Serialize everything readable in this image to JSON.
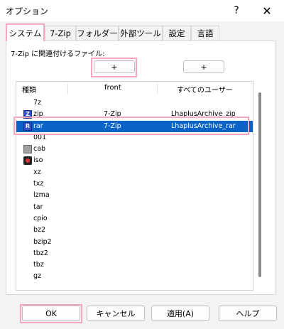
{
  "window": {
    "title": "オプション",
    "help_glyph": "?",
    "close_glyph": "✕"
  },
  "tabs": [
    {
      "label": "システム",
      "active": true
    },
    {
      "label": "7-Zip"
    },
    {
      "label": "フォルダー"
    },
    {
      "label": "外部ツール"
    },
    {
      "label": "設定"
    },
    {
      "label": "言語"
    }
  ],
  "assoc": {
    "label": "7-Zip に関連付けるファイル:",
    "plus_button_1": "+",
    "plus_button_2": "+"
  },
  "list": {
    "columns": [
      "種類",
      "front",
      "すべてのユーザー"
    ],
    "rows": [
      {
        "ext": "7z",
        "front": "",
        "all": "",
        "icon": ""
      },
      {
        "ext": "zip",
        "front": "7-Zip",
        "all": "LhaplusArchive_zip",
        "icon": "zip-archive-icon",
        "icon_glyph": "Z"
      },
      {
        "ext": "rar",
        "front": "7-Zip",
        "all": "LhaplusArchive_rar",
        "icon": "rar-archive-icon",
        "icon_glyph": "R",
        "selected": true
      },
      {
        "ext": "001",
        "front": "",
        "all": "",
        "icon": ""
      },
      {
        "ext": "cab",
        "front": "",
        "all": "",
        "icon": "cab-archive-icon"
      },
      {
        "ext": "iso",
        "front": "",
        "all": "",
        "icon": "iso-disc-icon"
      },
      {
        "ext": "xz",
        "front": "",
        "all": "",
        "icon": ""
      },
      {
        "ext": "txz",
        "front": "",
        "all": "",
        "icon": ""
      },
      {
        "ext": "lzma",
        "front": "",
        "all": "",
        "icon": ""
      },
      {
        "ext": "tar",
        "front": "",
        "all": "",
        "icon": ""
      },
      {
        "ext": "cpio",
        "front": "",
        "all": "",
        "icon": ""
      },
      {
        "ext": "bz2",
        "front": "",
        "all": "",
        "icon": ""
      },
      {
        "ext": "bzip2",
        "front": "",
        "all": "",
        "icon": ""
      },
      {
        "ext": "tbz2",
        "front": "",
        "all": "",
        "icon": ""
      },
      {
        "ext": "tbz",
        "front": "",
        "all": "",
        "icon": ""
      },
      {
        "ext": "gz",
        "front": "",
        "all": "",
        "icon": ""
      }
    ]
  },
  "footer": {
    "ok": "OK",
    "cancel": "キャンセル",
    "apply": "適用(A)",
    "help": "ヘルプ"
  },
  "colors": {
    "highlight": "#f4a8c0",
    "selection": "#0a64c8"
  }
}
